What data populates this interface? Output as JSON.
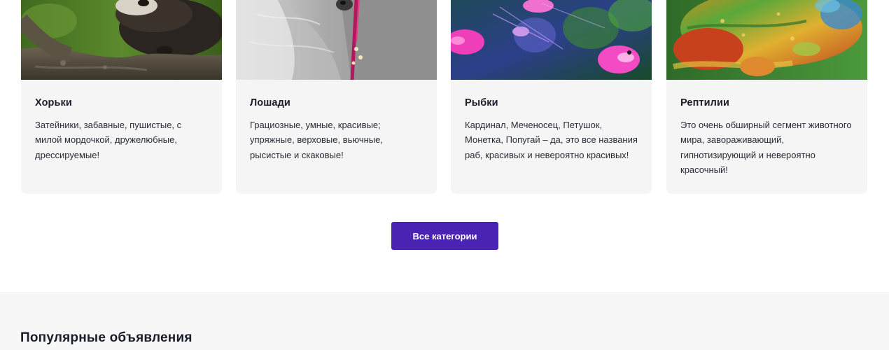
{
  "categories": [
    {
      "title": "Хорьки",
      "desc": "Затейники, забавные, пушистые, с милой мордочкой, дружелюбные, дрессируемые!",
      "image": "ferret-photo"
    },
    {
      "title": "Лошади",
      "desc": "Грациозные, умные, красивые; упряжные, верховые, вьючные, рысистые и скаковые!",
      "image": "horse-photo"
    },
    {
      "title": "Рыбки",
      "desc": "Кардинал, Меченосец, Петушок, Монетка, Попугай – да, это все названия раб, красивых и невероятно красивых!",
      "image": "fish-photo"
    },
    {
      "title": "Рептилии",
      "desc": "Это очень обширный сегмент животного мира, завораживающий, гипнотизирующий и невероятно красочный!",
      "image": "chameleon-photo"
    }
  ],
  "all_categories_label": "Все категории",
  "popular_section": {
    "title": "Популярные объявления"
  },
  "colors": {
    "accent": "#4a23b3",
    "card_bg": "#f5f5f5",
    "section_bg": "#f7f7f7"
  }
}
